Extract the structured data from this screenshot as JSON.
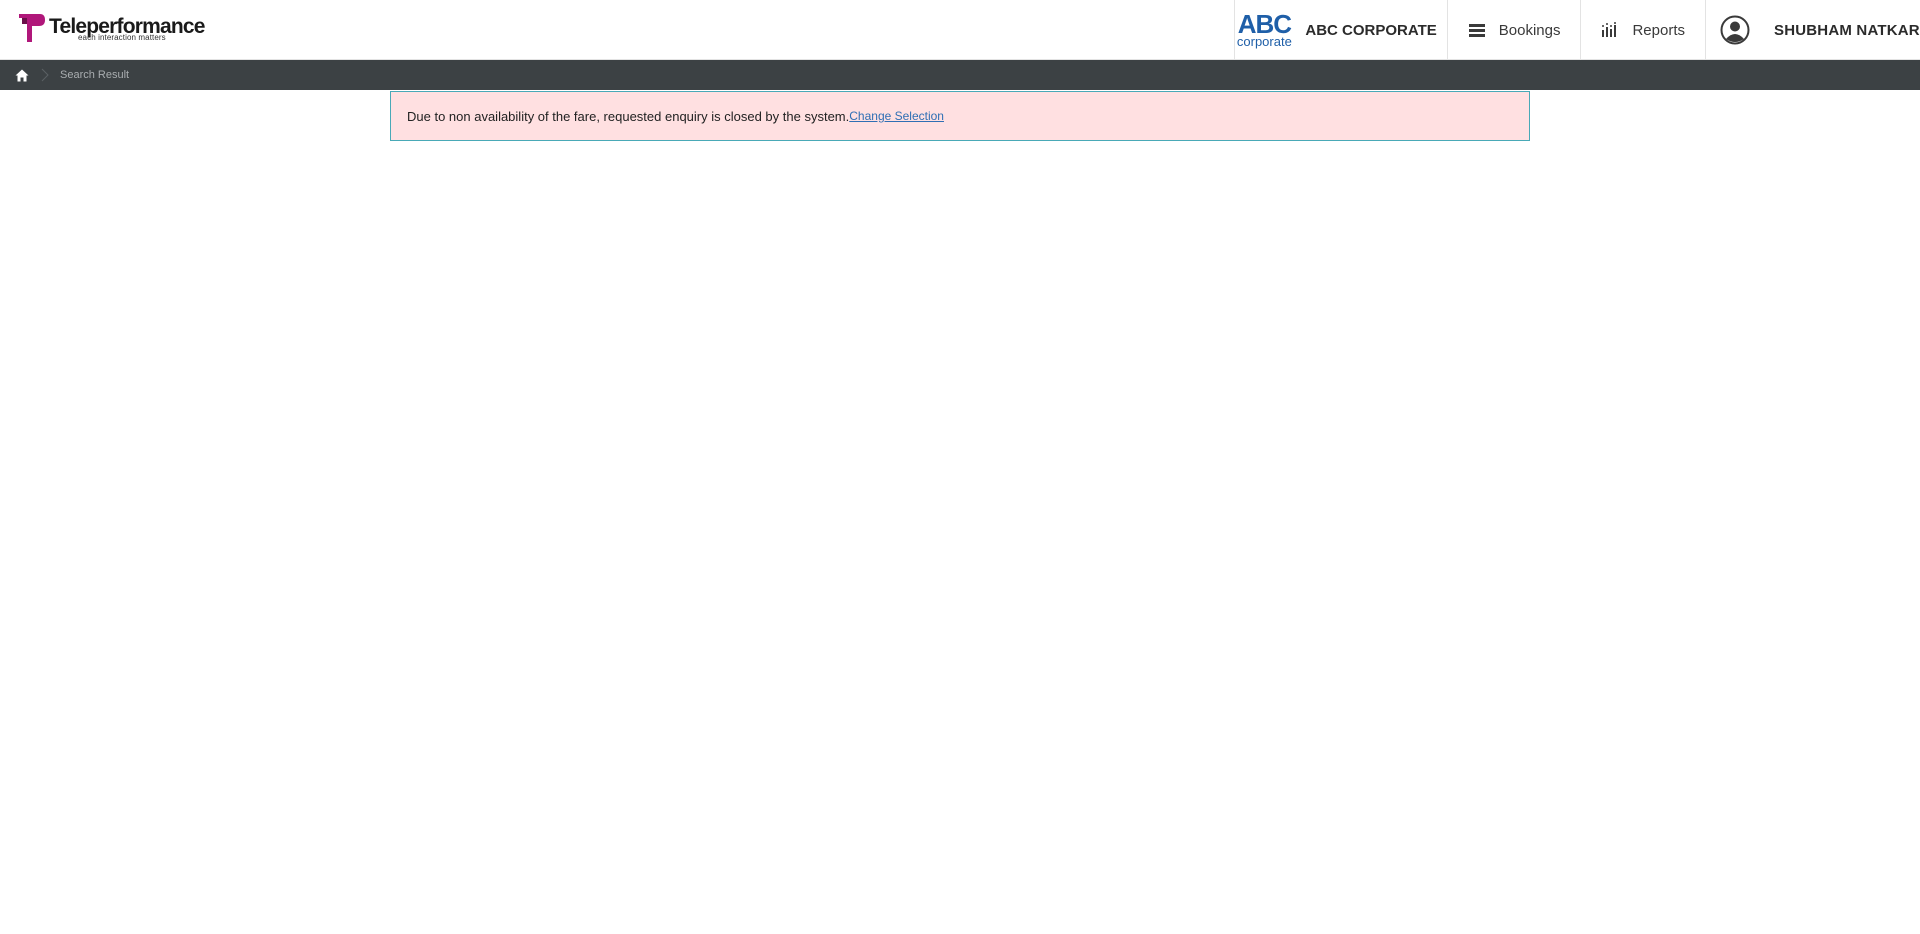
{
  "header": {
    "logo": {
      "name": "Teleperformance",
      "tagline": "each interaction matters",
      "brand_color": "#b0177a"
    },
    "corporate": {
      "logo_big": "ABC",
      "logo_small": "corporate",
      "name": "ABC CORPORATE",
      "logo_color": "#1f5fa8"
    },
    "nav": {
      "bookings_label": "Bookings",
      "reports_label": "Reports"
    },
    "user": {
      "name": "SHUBHAM NATKAR"
    }
  },
  "breadcrumb": {
    "items": [
      "Search Result"
    ],
    "background": "#3c4144"
  },
  "alert": {
    "message": "Due to non availability of the fare, requested enquiry is closed by the system.",
    "link_label": "Change Selection",
    "background": "#ffe0e1",
    "border": "#49a9b7"
  }
}
